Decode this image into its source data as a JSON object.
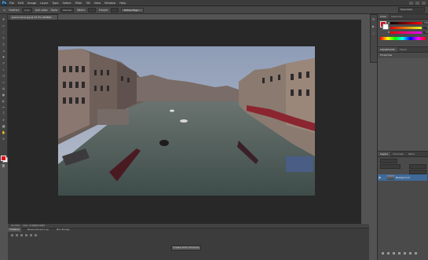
{
  "menu": {
    "logo": "Ps",
    "items": [
      "File",
      "Edit",
      "Image",
      "Layer",
      "Type",
      "Select",
      "Filter",
      "3D",
      "View",
      "Window",
      "Help"
    ]
  },
  "options": {
    "feather_label": "Feather:",
    "feather_value": "0 px",
    "antialias": "Anti-alias",
    "style_label": "Style:",
    "style_value": "Normal",
    "width_label": "Width:",
    "height_label": "Height:",
    "refine_button": "Refine Edge...",
    "workspace": "Essentials"
  },
  "document": {
    "tab_title": "grand-canal.jpg @ 33.3% (RGB/8)"
  },
  "color_panel": {
    "tabs": [
      "Color",
      "Swatches"
    ],
    "r": "230",
    "g": "7",
    "b": "27",
    "channels": [
      "R",
      "G",
      "B"
    ]
  },
  "adjustments_panel": {
    "tabs": [
      "Adjustments",
      "Styles"
    ]
  },
  "properties_panel": {
    "title": "Properties"
  },
  "layers_panel": {
    "tabs": [
      "Layers",
      "Channels",
      "Paths"
    ],
    "layer_name": "Background"
  },
  "status": {
    "zoom": "33.33%",
    "doc_info": "Doc: 3.00M/3.00M"
  },
  "timeline": {
    "tabs": [
      "Timeline",
      "Measurement Log",
      "Mini Bridge"
    ],
    "create_button": "Create Video Timeline"
  },
  "colors": {
    "foreground": "#e3071b",
    "background": "#ffffff",
    "ui_dark": "#282828",
    "selected_layer": "#3f6a9a"
  }
}
